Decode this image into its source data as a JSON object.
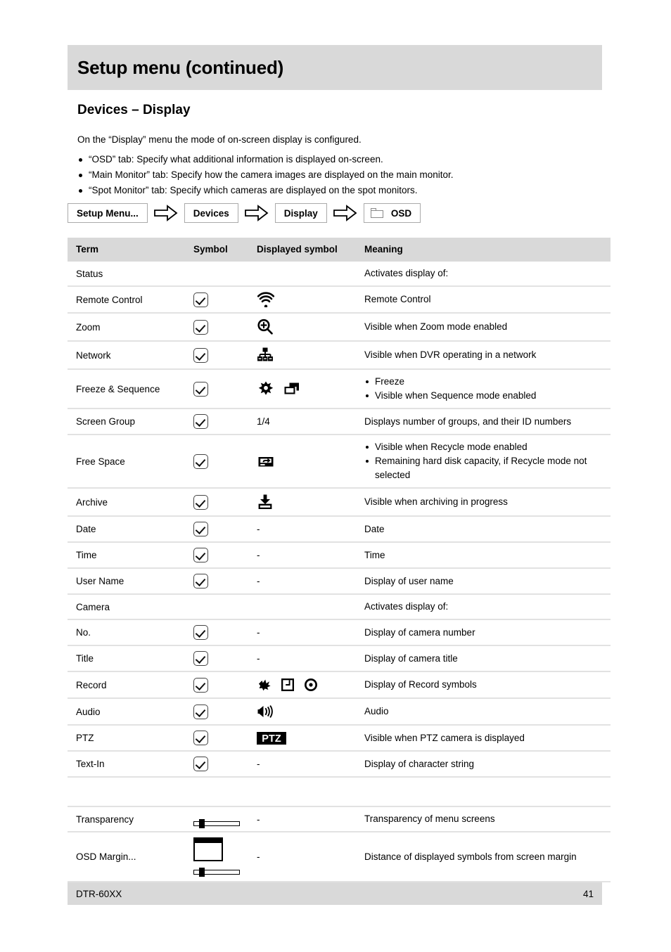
{
  "header": {
    "title": "Setup menu (continued)"
  },
  "section": {
    "heading": "Devices – Display",
    "lead": "On the “Display” menu the mode of on-screen display is configured.",
    "bullets": [
      "“OSD” tab: Specify what additional information is displayed on-screen.",
      "“Main Monitor” tab: Specify how the camera images are displayed on the main monitor.",
      "“Spot Monitor” tab: Specify which cameras are displayed on the spot monitors."
    ]
  },
  "breadcrumb": {
    "steps": [
      {
        "label": "Setup Menu...",
        "icon": ""
      },
      {
        "label": "Devices",
        "icon": ""
      },
      {
        "label": "Display",
        "icon": ""
      },
      {
        "label": "OSD",
        "icon": "folder-icon"
      }
    ],
    "separator_icon": "right-arrow-icon"
  },
  "table": {
    "columns": [
      "Term",
      "Symbol",
      "Displayed symbol",
      "Meaning"
    ],
    "rows": [
      {
        "term": "Status",
        "symbol": "",
        "displayed": [],
        "displayed_text": "",
        "meaning": "Activates display of:"
      },
      {
        "term": "Remote Control",
        "symbol": "checkbox-checked",
        "displayed": [
          "wifi-signal-icon"
        ],
        "displayed_text": "",
        "meaning": "Remote Control"
      },
      {
        "term": "Zoom",
        "symbol": "checkbox-checked",
        "displayed": [
          "magnifier-plus-icon"
        ],
        "displayed_text": "",
        "meaning": "Visible when Zoom mode enabled"
      },
      {
        "term": "Network",
        "symbol": "checkbox-checked",
        "displayed": [
          "network-nodes-icon"
        ],
        "displayed_text": "",
        "meaning": "Visible when DVR operating in a network"
      },
      {
        "term": "Freeze & Sequence",
        "symbol": "checkbox-checked",
        "displayed": [
          "snowflake-freeze-icon",
          "sequence-windows-icon"
        ],
        "displayed_text": "",
        "meaning_bullets": [
          "Freeze",
          "Visible when Sequence mode enabled"
        ]
      },
      {
        "term": "Screen Group",
        "symbol": "checkbox-checked",
        "displayed": [],
        "displayed_text": "1/4",
        "meaning": "Displays number of groups, and their ID numbers"
      },
      {
        "term": "Free Space",
        "symbol": "checkbox-checked",
        "displayed": [
          "recycle-disk-icon"
        ],
        "displayed_text": "",
        "meaning_bullets": [
          "Visible when Recycle mode enabled",
          "Remaining hard disk capacity, if Recycle mode not selected"
        ]
      },
      {
        "term": "Archive",
        "symbol": "checkbox-checked",
        "displayed": [
          "archive-tray-icon"
        ],
        "displayed_text": "",
        "meaning": "Visible when archiving in progress"
      },
      {
        "term": "Date",
        "symbol": "checkbox-checked",
        "displayed": [],
        "displayed_text": "-",
        "meaning": "Date"
      },
      {
        "term": "Time",
        "symbol": "checkbox-checked",
        "displayed": [],
        "displayed_text": "-",
        "meaning": "Time"
      },
      {
        "term": "User Name",
        "symbol": "checkbox-checked",
        "displayed": [],
        "displayed_text": "-",
        "meaning": "Display of user name"
      },
      {
        "term": "Camera",
        "symbol": "",
        "displayed": [],
        "displayed_text": "",
        "meaning": "Activates display of:"
      },
      {
        "term": "No.",
        "symbol": "checkbox-checked",
        "displayed": [],
        "displayed_text": "-",
        "meaning": "Display of camera number"
      },
      {
        "term": "Title",
        "symbol": "checkbox-checked",
        "displayed": [],
        "displayed_text": "-",
        "meaning": "Display of camera title"
      },
      {
        "term": "Record",
        "symbol": "checkbox-checked",
        "displayed": [
          "motion-event-icon",
          "clock-schedule-icon",
          "record-dot-icon"
        ],
        "displayed_text": "",
        "meaning": "Display of Record symbols"
      },
      {
        "term": "Audio",
        "symbol": "checkbox-checked",
        "displayed": [
          "speaker-audio-icon"
        ],
        "displayed_text": "",
        "meaning": "Audio"
      },
      {
        "term": "PTZ",
        "symbol": "checkbox-checked",
        "displayed": [
          "ptz-badge-icon"
        ],
        "displayed_text": "",
        "meaning": "Visible when PTZ camera is displayed"
      },
      {
        "term": "Text-In",
        "symbol": "checkbox-checked",
        "displayed": [],
        "displayed_text": "-",
        "meaning": "Display of character string"
      },
      {
        "term": "Transparency",
        "symbol": "slider-control",
        "displayed": [],
        "displayed_text": "-",
        "meaning": "Transparency of menu screens"
      },
      {
        "term": "OSD Margin...",
        "symbol": "margin-box-and-slider",
        "displayed": [],
        "displayed_text": "-",
        "meaning": "Distance of displayed symbols from screen margin"
      }
    ]
  },
  "footer": {
    "model": "DTR-60XX",
    "page_number": "41"
  },
  "colors": {
    "band": "#d9d9d9",
    "rule": "#e2e2e2",
    "text": "#000000"
  }
}
